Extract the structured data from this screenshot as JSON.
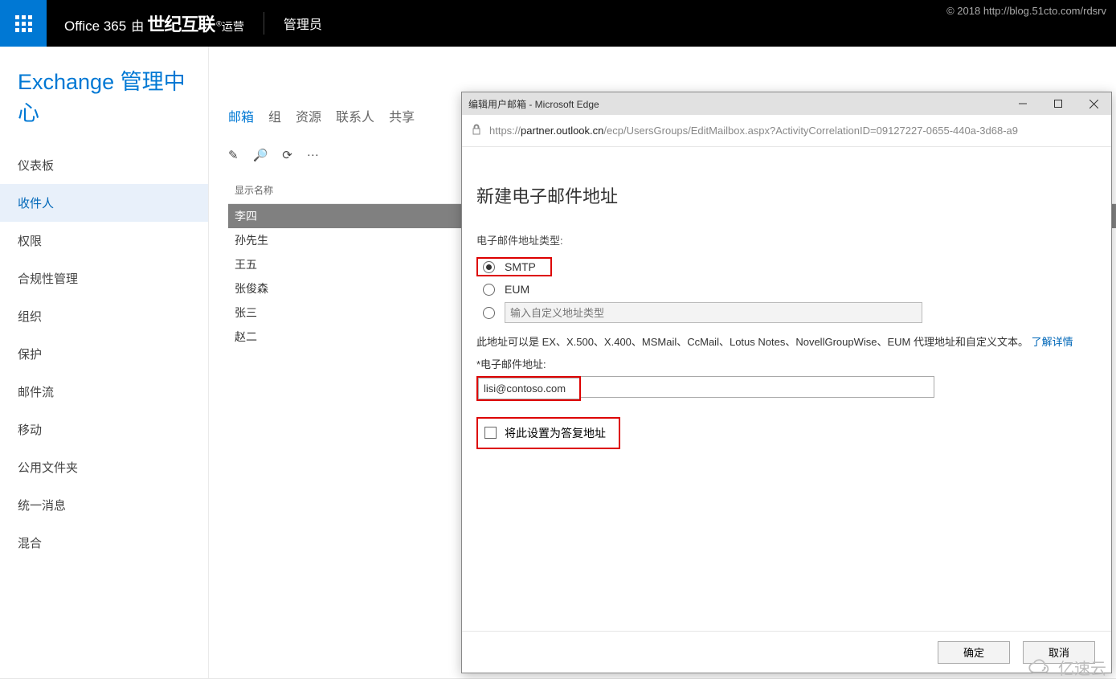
{
  "copyright": "© 2018 http://blog.51cto.com/rdsrv",
  "topbar": {
    "office": "Office 365",
    "by": "由",
    "operator_bold": "世纪互联",
    "operator_tail": "运营",
    "admin": "管理员"
  },
  "page": {
    "title": "Exchange 管理中心"
  },
  "nav": {
    "items": [
      {
        "label": "仪表板"
      },
      {
        "label": "收件人",
        "active": true
      },
      {
        "label": "权限"
      },
      {
        "label": "合规性管理"
      },
      {
        "label": "组织"
      },
      {
        "label": "保护"
      },
      {
        "label": "邮件流"
      },
      {
        "label": "移动"
      },
      {
        "label": "公用文件夹"
      },
      {
        "label": "统一消息"
      },
      {
        "label": "混合"
      }
    ]
  },
  "subnav": {
    "items": [
      {
        "label": "邮箱",
        "active": true
      },
      {
        "label": "组"
      },
      {
        "label": "资源"
      },
      {
        "label": "联系人"
      },
      {
        "label": "共享"
      }
    ]
  },
  "toolbar": {
    "edit": "✎",
    "search": "🔍",
    "refresh": "⟳",
    "more": "···"
  },
  "list": {
    "header": "显示名称",
    "rows": [
      {
        "name": "李四",
        "selected": true
      },
      {
        "name": "孙先生"
      },
      {
        "name": "王五"
      },
      {
        "name": "张俊森"
      },
      {
        "name": "张三"
      },
      {
        "name": "赵二"
      }
    ]
  },
  "popup": {
    "window_title": "编辑用户邮箱 - Microsoft Edge",
    "url_prefix": "https://",
    "url_host": "partner.outlook.cn",
    "url_path": "/ecp/UsersGroups/EditMailbox.aspx?ActivityCorrelationID=09127227-0655-440a-3d68-a9",
    "dlg_title": "新建电子邮件地址",
    "type_label": "电子邮件地址类型:",
    "opt_smtp": "SMTP",
    "opt_eum": "EUM",
    "custom_placeholder": "输入自定义地址类型",
    "help_text": "此地址可以是 EX、X.500、X.400、MSMail、CcMail、Lotus Notes、NovellGroupWise、EUM 代理地址和自定义文本。",
    "learn_more": "了解详情",
    "email_label": "*电子邮件地址:",
    "email_value": "lisi@contoso.com",
    "reply_label": "将此设置为答复地址",
    "ok": "确定",
    "cancel": "取消"
  },
  "watermark": "亿速云"
}
